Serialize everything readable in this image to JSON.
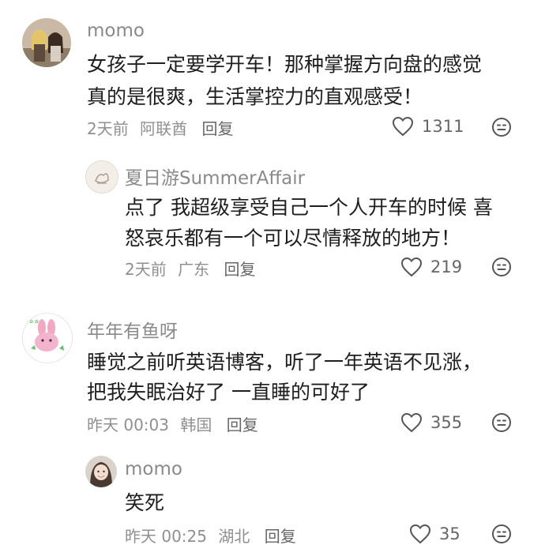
{
  "comments": [
    {
      "username": "momo",
      "lines": [
        "女孩子一定要学开车！那种掌握方向盘的感觉",
        "真的是很爽，生活掌控力的直观感受！"
      ],
      "time": "2天前",
      "location": "阿联酋",
      "reply_label": "回复",
      "likes": "1311",
      "avatar_icon": "dolls-avatar-icon"
    },
    {
      "username": "夏日游SummerAffair",
      "lines": [
        "点了 我超级享受自己一个人开车的时候 喜",
        "怒哀乐都有一个可以尽情释放的地方！"
      ],
      "time": "2天前",
      "location": "广东",
      "reply_label": "回复",
      "likes": "219",
      "avatar_icon": "sketch-avatar-icon"
    },
    {
      "username": "年年有鱼呀",
      "lines": [
        "睡觉之前听英语博客，听了一年英语不见涨，",
        "把我失眠治好了 一直睡的可好了"
      ],
      "time": "昨天 00:03",
      "location": "韩国",
      "reply_label": "回复",
      "likes": "355",
      "avatar_icon": "pink-rabbit-avatar-icon"
    },
    {
      "username": "momo",
      "lines": [
        "笑死"
      ],
      "time": "昨天 00:25",
      "location": "湖北",
      "reply_label": "回复",
      "likes": "35",
      "avatar_icon": "portrait-avatar-icon"
    }
  ],
  "colors": {
    "username": "#8a8a8a",
    "text": "#1e1e1e",
    "meta": "#8f8f8f",
    "icon": "#555555"
  },
  "icons": {
    "like": "heart-outline-icon",
    "more": "emoji-face-icon"
  }
}
